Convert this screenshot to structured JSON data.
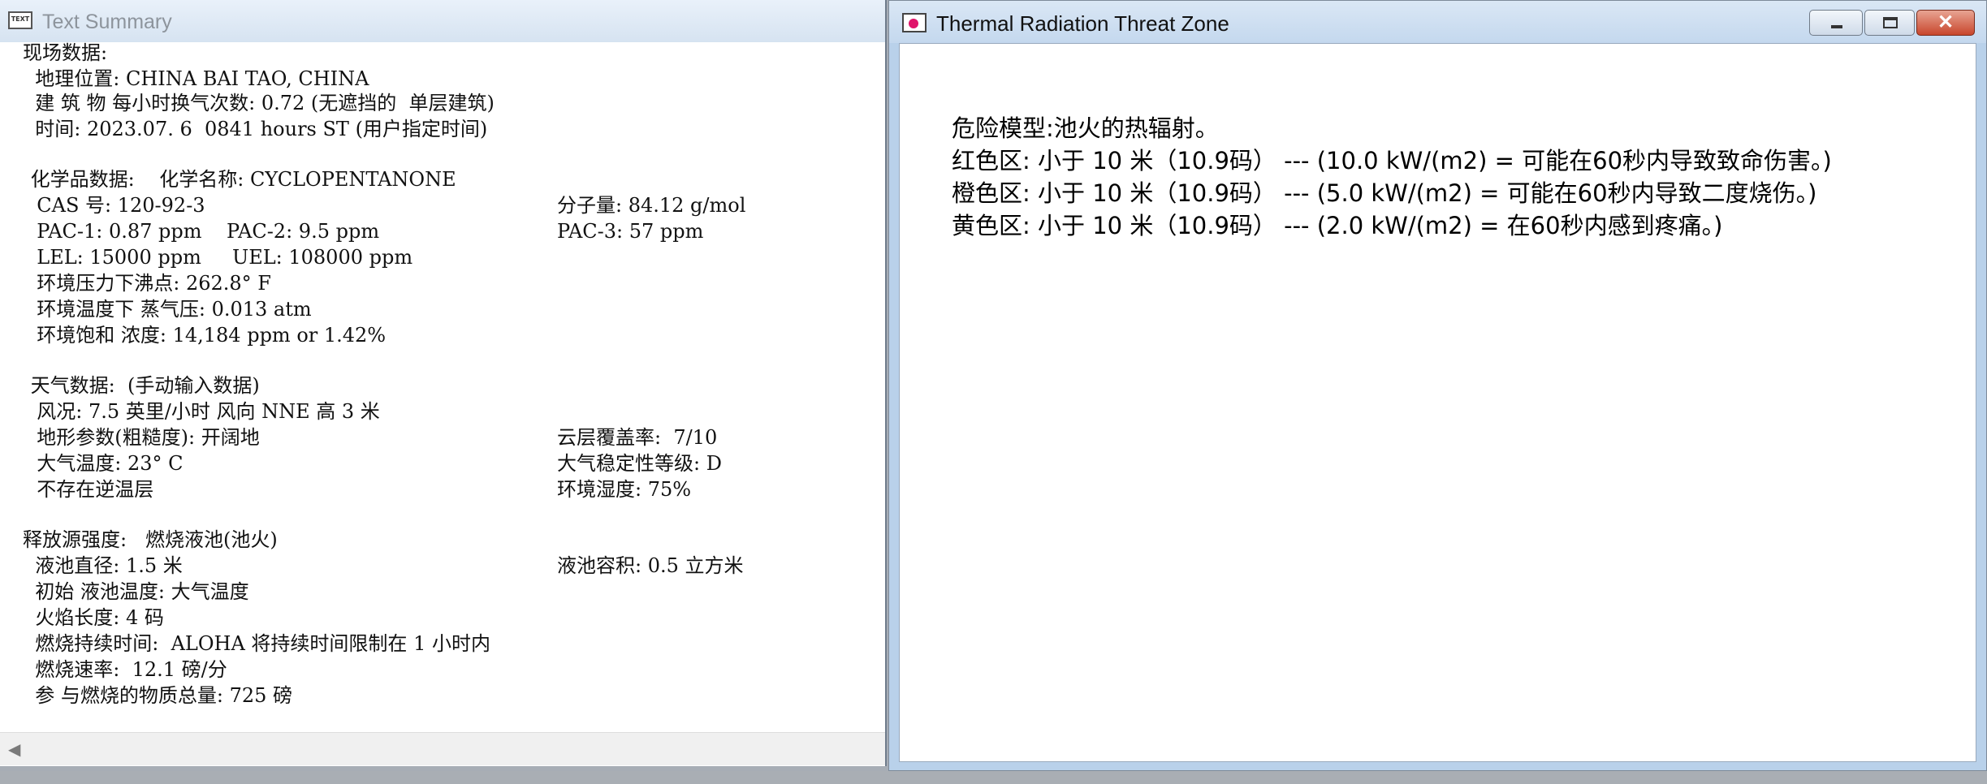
{
  "text_summary": {
    "title": "Text Summary",
    "icon_label": "TEXT",
    "lines": [
      "现场数据:",
      "  地理位置: CHINA BAI TAO, CHINA",
      "  建 筑 物 每小时换气次数: 0.72 (无遮挡的  单层建筑)",
      "  时间: 2023.07. 6  0841 hours ST (用户指定时间)",
      " 化学品数据:    化学名称: CYCLOPENTANONE",
      "  CAS 号: 120-92-3",
      "分子量: 84.12 g/mol",
      "  PAC-1: 0.87 ppm    PAC-2: 9.5 ppm",
      "PAC-3: 57 ppm",
      "  LEL: 15000 ppm     UEL: 108000 ppm",
      "  环境压力下沸点: 262.8° F",
      "  环境温度下 蒸气压: 0.013 atm",
      "  环境饱和 浓度: 14,184 ppm or 1.42%",
      " 天气数据:  (手动输入数据)",
      "  风况: 7.5 英里/小时 风向 NNE 高 3 米",
      "  地形参数(粗糙度): 开阔地",
      "云层覆盖率:  7/10",
      "  大气温度: 23° C",
      "大气稳定性等级: D",
      "  不存在逆温层",
      "环境湿度: 75%",
      "释放源强度:   燃烧液池(池火)",
      "  液池直径: 1.5 米",
      "液池容积: 0.5 立方米",
      "  初始 液池温度: 大气温度",
      "  火焰长度: 4 码",
      "  燃烧持续时间:  ALOHA 将持续时间限制在 1 小时内",
      "  燃烧速率:  12.1 磅/分",
      "  参 与燃烧的物质总量: 725 磅"
    ],
    "scroll_left_glyph": "◀"
  },
  "threat_zone": {
    "title": "Thermal Radiation Threat Zone",
    "buttons": {
      "minimize": "minimize",
      "maximize": "maximize",
      "close": "✕"
    },
    "lines": [
      "危险模型:池火的热辐射。",
      "红色区: 小于 10 米（10.9码） --- (10.0 kW/(m2) = 可能在60秒内导致致命伤害。)",
      "橙色区: 小于 10 米（10.9码） --- (5.0 kW/(m2) = 可能在60秒内导致二度烧伤。)",
      "黄色区: 小于 10 米（10.9码） --- (2.0 kW/(m2) = 在60秒内感到疼痛。)"
    ]
  },
  "colors": {
    "close_button": "#c8462c",
    "icon_dot": "#e0136a",
    "inactive_title": "#8d949c"
  }
}
